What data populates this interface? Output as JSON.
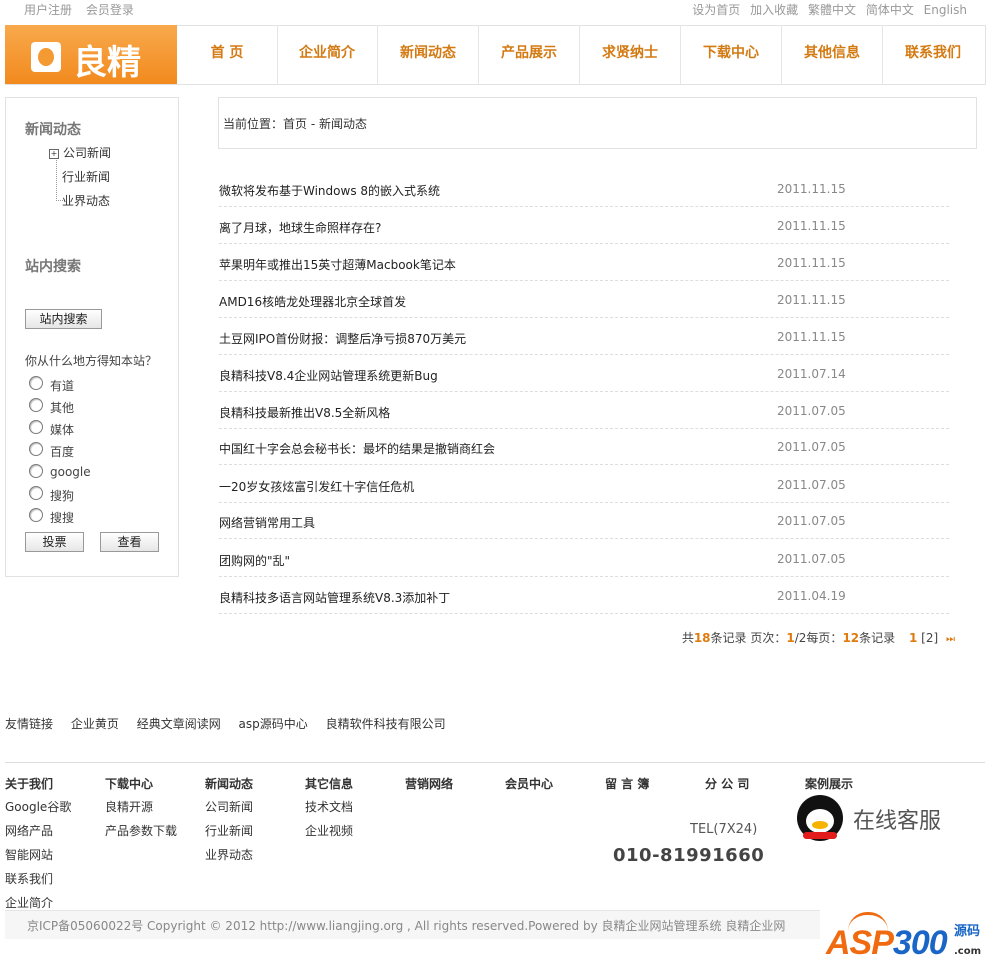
{
  "topbar": {
    "left": [
      "用户注册",
      "会员登录"
    ],
    "right": [
      "设为首页",
      "加入收藏",
      "繁體中文",
      "简体中文",
      "English"
    ]
  },
  "logo": {
    "text": "良精"
  },
  "nav": [
    "首 页",
    "企业简介",
    "新闻动态",
    "产品展示",
    "求贤纳士",
    "下载中心",
    "其他信息",
    "联系我们"
  ],
  "sidebar": {
    "news_title": "新闻动态",
    "news_items": [
      "公司新闻",
      "行业新闻",
      "业界动态"
    ],
    "search_title": "站内搜索",
    "search_button": "站内搜索",
    "poll_question": "你从什么地方得知本站？",
    "poll_options": [
      "有道",
      "其他",
      "媒体",
      "百度",
      "google",
      "搜狗",
      "搜搜"
    ],
    "vote_button": "投票",
    "view_button": "查看"
  },
  "breadcrumb": {
    "label": "当前位置：",
    "home": "首页",
    "sep": " - ",
    "current": "新闻动态"
  },
  "articles": [
    {
      "title": "微软将发布基于Windows 8的嵌入式系统",
      "date": "2011.11.15"
    },
    {
      "title": "离了月球，地球生命照样存在?",
      "date": "2011.11.15"
    },
    {
      "title": "苹果明年或推出15英寸超薄Macbook笔记本",
      "date": "2011.11.15"
    },
    {
      "title": "AMD16核皓龙处理器北京全球首发",
      "date": "2011.11.15"
    },
    {
      "title": "土豆网IPO首份财报：调整后净亏损870万美元",
      "date": "2011.11.15"
    },
    {
      "title": "良精科技V8.4企业网站管理系统更新Bug",
      "date": "2011.07.14"
    },
    {
      "title": "良精科技最新推出V8.5全新风格",
      "date": "2011.07.05"
    },
    {
      "title": "中国红十字会总会秘书长：最坏的结果是撤销商红会",
      "date": "2011.07.05"
    },
    {
      "title": "一20岁女孩炫富引发红十字信任危机",
      "date": "2011.07.05"
    },
    {
      "title": "网络营销常用工具",
      "date": "2011.07.05"
    },
    {
      "title": "团购网的\"乱\"",
      "date": "2011.07.05"
    },
    {
      "title": "良精科技多语言网站管理系统V8.3添加补丁",
      "date": "2011.04.19"
    }
  ],
  "pager": {
    "total_prefix": "共",
    "total": "18",
    "total_suffix": "条记录",
    "page_prefix": "页次：",
    "page_current": "1",
    "page_total": "/2每页：",
    "per_page": "12",
    "per_page_suffix": "条记录",
    "current_page": "1",
    "other_page": "[2]",
    "last_symbol": "⏭"
  },
  "friend_links": {
    "label": "友情链接",
    "items": [
      "企业黄页",
      "经典文章阅读网",
      "asp源码中心",
      "良精软件科技有限公司"
    ]
  },
  "footer_cols": [
    {
      "title": "关于我们",
      "items": [
        "Google谷歌",
        "网络产品",
        "智能网站",
        "联系我们",
        "企业简介"
      ]
    },
    {
      "title": "下载中心",
      "items": [
        "良精开源",
        "产品参数下载"
      ]
    },
    {
      "title": "新闻动态",
      "items": [
        "公司新闻",
        "行业新闻",
        "业界动态"
      ]
    },
    {
      "title": "其它信息",
      "items": [
        "技术文档",
        "企业视频"
      ]
    },
    {
      "title": "营销网络",
      "items": []
    },
    {
      "title": "会员中心",
      "items": []
    },
    {
      "title": "留 言 簿",
      "items": []
    },
    {
      "title": "分 公 司",
      "items": []
    },
    {
      "title": "案例展示",
      "items": []
    }
  ],
  "contact": {
    "tel_label": "TEL(7X24)",
    "phone": "010-81991660",
    "qq_text": "在线客服"
  },
  "copyright": "京ICP备05060022号  Copyright © 2012 http://www.liangjing.org , All rights reserved.Powered by 良精企业网站管理系统  良精企业网",
  "badge": {
    "asp": "ASP",
    "num": "300",
    "small": "源码",
    "com": ".com"
  },
  "colors": {
    "accent": "#f28a1e",
    "nav_text": "#d47a12",
    "highlight": "#e07b0f"
  }
}
